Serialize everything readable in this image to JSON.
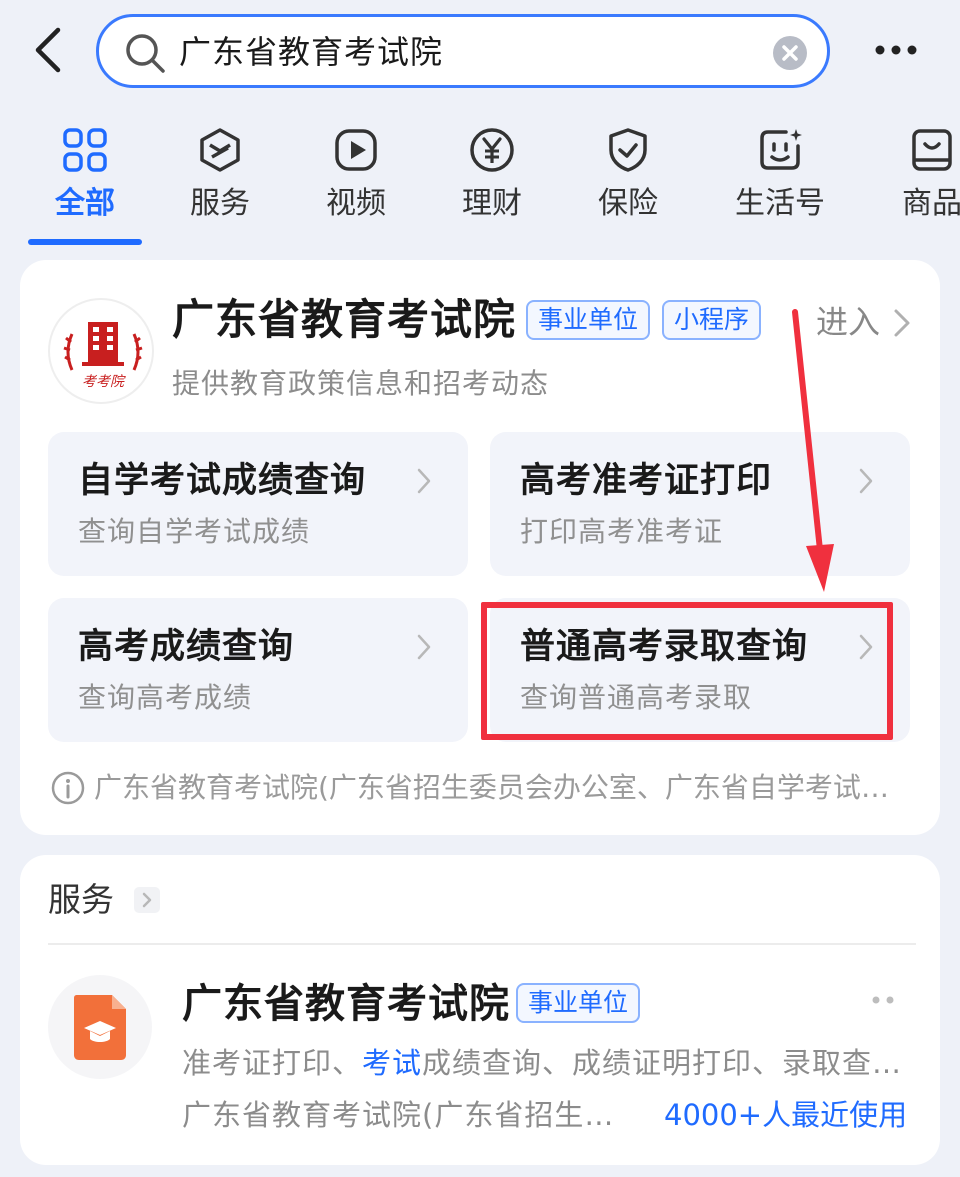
{
  "search": {
    "query": "广东省教育考试院"
  },
  "tabs": [
    {
      "label": "全部",
      "icon": "grid-icon",
      "active": true
    },
    {
      "label": "服务",
      "icon": "cube-icon"
    },
    {
      "label": "视频",
      "icon": "play-icon"
    },
    {
      "label": "理财",
      "icon": "yen-icon"
    },
    {
      "label": "保险",
      "icon": "shield-icon"
    },
    {
      "label": "生活号",
      "icon": "life-account-icon"
    },
    {
      "label": "商品",
      "icon": "shopping-bag-icon"
    }
  ],
  "org_card": {
    "title": "广东省教育考试院",
    "tags": [
      "事业单位",
      "小程序"
    ],
    "enter_label": "进入",
    "description": "提供教育政策信息和招考动态",
    "logo_text": "考考院",
    "services": [
      {
        "title": "自学考试成绩查询",
        "subtitle": "查询自学考试成绩"
      },
      {
        "title": "高考准考证打印",
        "subtitle": "打印高考准考证"
      },
      {
        "title": "高考成绩查询",
        "subtitle": "查询高考成绩"
      },
      {
        "title": "普通高考录取查询",
        "subtitle": "查询普通高考录取",
        "highlighted": true
      }
    ],
    "info_text": "广东省教育考试院(广东省招生委员会办公室、广东省自学考试委员会办公室)"
  },
  "services_section": {
    "title": "服务",
    "app": {
      "title": "广东省教育考试院",
      "tag": "事业单位",
      "desc_before": "准考证打印、",
      "desc_highlight": "考试",
      "desc_after": "成绩查询、成绩证明打印、录取查询",
      "org": "广东省教育考试院(广东省招生委员会办公室)",
      "users": "4000+人最近使用"
    }
  },
  "colors": {
    "accent": "#1f6bff",
    "annotation_red": "#f0303e",
    "app_icon_orange": "#f2703a"
  }
}
